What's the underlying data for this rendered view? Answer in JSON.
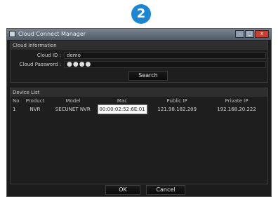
{
  "step_badge": "2",
  "window": {
    "title": "Cloud Connect Manager",
    "controls": {
      "minimize": "–",
      "maximize": "□",
      "close": "x"
    }
  },
  "cloud_info": {
    "header": "Cloud Information",
    "cloud_id_label": "Cloud ID :",
    "cloud_id_value": "demo",
    "cloud_password_label": "Cloud Password :",
    "cloud_password_value": "●●●●",
    "search_button": "Search"
  },
  "device_list": {
    "header": "Device List",
    "columns": [
      "No",
      "Product",
      "Model",
      "Mac",
      "Public IP",
      "Private IP"
    ],
    "rows": [
      [
        "1",
        "NVR",
        "SECUNET NVR",
        "00:00:02:52:6E:01",
        "121.98.182.209",
        "192.168.20.222"
      ]
    ]
  },
  "footer": {
    "ok_button": "OK",
    "cancel_button": "Cancel"
  },
  "colors": {
    "badge": "#1b87d4",
    "window_bg": "#1c1c1c",
    "titlebar": "#5e6a77"
  }
}
